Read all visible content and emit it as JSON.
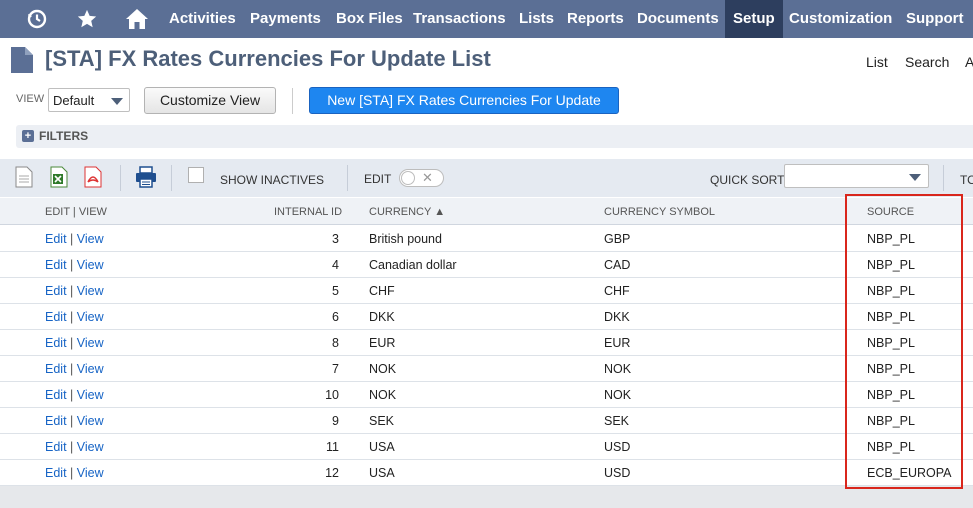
{
  "nav": {
    "icons": [
      "recent-icon",
      "star-icon",
      "home-icon"
    ],
    "items": [
      {
        "label": "Activities",
        "active": false
      },
      {
        "label": "Payments",
        "active": false
      },
      {
        "label": "Box Files",
        "active": false
      },
      {
        "label": "Transactions",
        "active": false
      },
      {
        "label": "Lists",
        "active": false
      },
      {
        "label": "Reports",
        "active": false
      },
      {
        "label": "Documents",
        "active": false
      },
      {
        "label": "Setup",
        "active": true
      },
      {
        "label": "Customization",
        "active": false
      },
      {
        "label": "Support",
        "active": false
      }
    ]
  },
  "page": {
    "title": "[STA] FX Rates Currencies For Update List",
    "links": [
      "List",
      "Search",
      "A"
    ]
  },
  "view": {
    "label": "VIEW",
    "selected": "Default",
    "customize_label": "Customize View",
    "new_label": "New [STA] FX Rates Currencies For Update"
  },
  "filters": {
    "label": "FILTERS"
  },
  "toolbar": {
    "show_inactives": "SHOW INACTIVES",
    "edit_label": "EDIT",
    "quick_sort": "QUICK SORT",
    "quick_sort_value": "",
    "truncated": "TO"
  },
  "table": {
    "headers": {
      "edit_view": "EDIT | VIEW",
      "internal_id": "INTERNAL ID",
      "currency": "CURRENCY ▲",
      "symbol": "CURRENCY SYMBOL",
      "source": "SOURCE"
    },
    "edit_label": "Edit",
    "view_label": "View",
    "rows": [
      {
        "id": "3",
        "currency": "British pound",
        "symbol": "GBP",
        "source": "NBP_PL"
      },
      {
        "id": "4",
        "currency": "Canadian dollar",
        "symbol": "CAD",
        "source": "NBP_PL"
      },
      {
        "id": "5",
        "currency": "CHF",
        "symbol": "CHF",
        "source": "NBP_PL"
      },
      {
        "id": "6",
        "currency": "DKK",
        "symbol": "DKK",
        "source": "NBP_PL"
      },
      {
        "id": "8",
        "currency": "EUR",
        "symbol": "EUR",
        "source": "NBP_PL"
      },
      {
        "id": "7",
        "currency": "NOK",
        "symbol": "NOK",
        "source": "NBP_PL"
      },
      {
        "id": "10",
        "currency": "NOK",
        "symbol": "NOK",
        "source": "NBP_PL"
      },
      {
        "id": "9",
        "currency": "SEK",
        "symbol": "SEK",
        "source": "NBP_PL"
      },
      {
        "id": "11",
        "currency": "USA",
        "symbol": "USD",
        "source": "NBP_PL"
      },
      {
        "id": "12",
        "currency": "USA",
        "symbol": "USD",
        "source": "ECB_EUROPA"
      }
    ]
  }
}
